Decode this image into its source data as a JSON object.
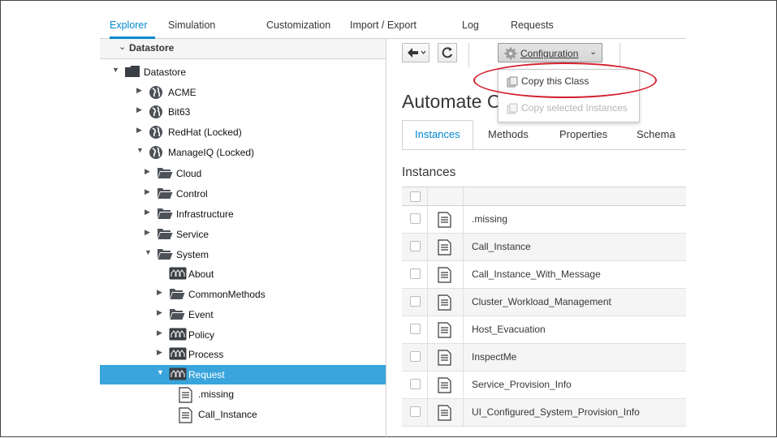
{
  "nav": {
    "tabs": [
      {
        "label": "Explorer",
        "active": true
      },
      {
        "label": "Simulation"
      },
      {
        "label": "Customization"
      },
      {
        "label": "Import / Export"
      },
      {
        "label": "Log"
      },
      {
        "label": "Requests"
      }
    ]
  },
  "accordion": {
    "title": "Datastore"
  },
  "tree": {
    "items": [
      {
        "label": "Datastore",
        "icon": "folder-dark-icon"
      },
      {
        "label": "ACME",
        "icon": "globe-icon"
      },
      {
        "label": "Bit63",
        "icon": "globe-icon"
      },
      {
        "label": "RedHat (Locked)",
        "icon": "globe-icon"
      },
      {
        "label": "ManageIQ (Locked)",
        "icon": "globe-icon"
      },
      {
        "label": "Cloud",
        "icon": "folder-open-icon"
      },
      {
        "label": "Control",
        "icon": "folder-open-icon"
      },
      {
        "label": "Infrastructure",
        "icon": "folder-open-icon"
      },
      {
        "label": "Service",
        "icon": "folder-open-icon"
      },
      {
        "label": "System",
        "icon": "folder-open-icon"
      },
      {
        "label": "About",
        "icon": "class-icon"
      },
      {
        "label": "CommonMethods",
        "icon": "folder-open-icon"
      },
      {
        "label": "Event",
        "icon": "folder-open-icon"
      },
      {
        "label": "Policy",
        "icon": "class-icon"
      },
      {
        "label": "Process",
        "icon": "class-icon"
      },
      {
        "label": "Request",
        "icon": "class-icon",
        "selected": true
      },
      {
        "label": ".missing",
        "icon": "document-icon"
      },
      {
        "label": "Call_Instance",
        "icon": "document-icon"
      }
    ]
  },
  "toolbar": {
    "back_icon": "arrow-left-icon",
    "refresh_icon": "refresh-icon",
    "config_label": "Configuration",
    "config_icon": "gear-icon"
  },
  "dropdown": {
    "items": [
      {
        "label": "Copy this Class",
        "enabled": true
      },
      {
        "label": "Copy selected Instances",
        "enabled": false
      }
    ]
  },
  "content": {
    "title": "Automate Class",
    "tabs": [
      "Instances",
      "Methods",
      "Properties",
      "Schema"
    ],
    "active_tab": "Instances",
    "instances_heading": "Instances",
    "instances": [
      ".missing",
      "Call_Instance",
      "Call_Instance_With_Message",
      "Cluster_Workload_Management",
      "Host_Evacuation",
      "InspectMe",
      "Service_Provision_Info",
      "UI_Configured_System_Provision_Info"
    ]
  },
  "colors": {
    "accent": "#0088ce",
    "selection": "#39a5dc",
    "annotation": "#d3202f"
  }
}
